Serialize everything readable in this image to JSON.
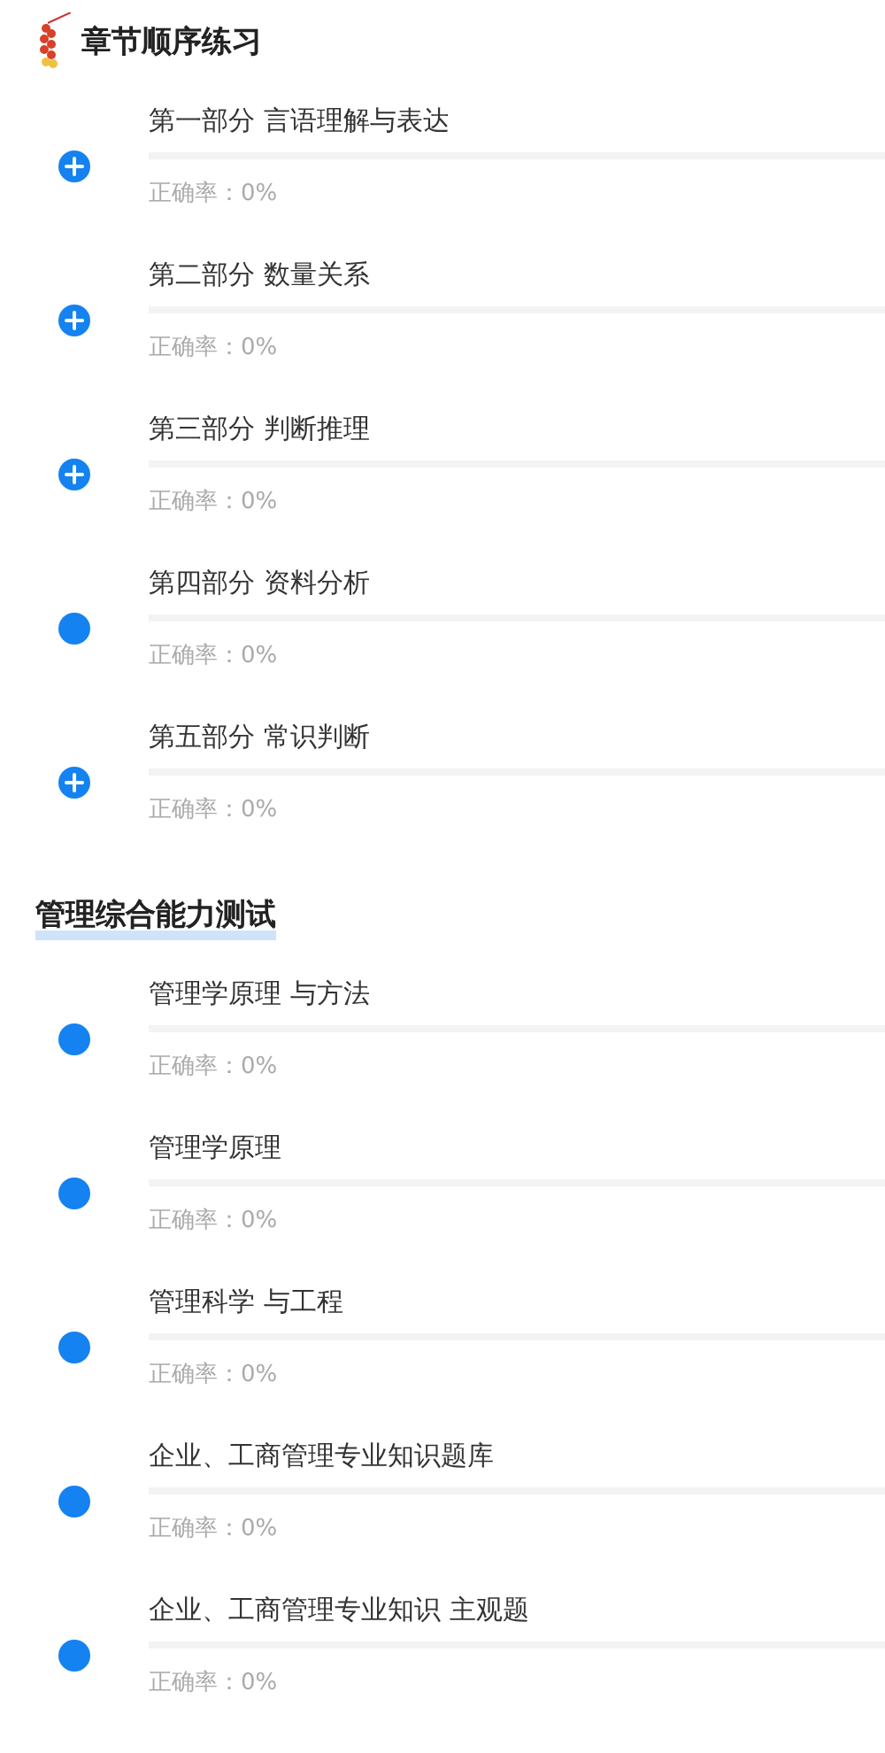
{
  "sections": [
    {
      "title": "章节顺序练习",
      "kind": "icon",
      "items": [
        {
          "kind": "expandable",
          "title": "第一部分 言语理解与表达",
          "accuracy": "正确率：0%"
        },
        {
          "kind": "expandable",
          "title": "第二部分 数量关系",
          "accuracy": "正确率：0%"
        },
        {
          "kind": "expandable",
          "title": "第三部分 判断推理",
          "accuracy": "正确率：0%"
        },
        {
          "kind": "dot",
          "title": "第四部分 资料分析",
          "accuracy": "正确率：0%"
        },
        {
          "kind": "expandable",
          "title": "第五部分 常识判断",
          "accuracy": "正确率：0%"
        }
      ]
    },
    {
      "title": "管理综合能力测试",
      "kind": "underline",
      "items": [
        {
          "kind": "dot",
          "title": "管理学原理 与方法",
          "accuracy": "正确率：0%"
        },
        {
          "kind": "dot",
          "title": "管理学原理",
          "accuracy": "正确率：0%"
        },
        {
          "kind": "dot",
          "title": "管理科学 与工程",
          "accuracy": "正确率：0%"
        },
        {
          "kind": "dot",
          "title": "企业、工商管理专业知识题库",
          "accuracy": "正确率：0%"
        },
        {
          "kind": "dot",
          "title": "企业、工商管理专业知识 主观题",
          "accuracy": "正确率：0%"
        }
      ]
    }
  ]
}
